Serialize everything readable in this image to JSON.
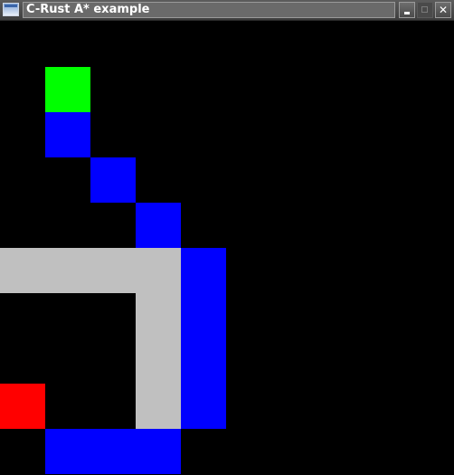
{
  "window": {
    "title": "C-Rust A* example",
    "buttons": {
      "minimize_icon": "minimize-icon",
      "maximize_icon": "maximize-icon",
      "close_icon": "close-icon",
      "close_glyph": "✕"
    }
  },
  "colors": {
    "background": "#000000",
    "start": "#00ff00",
    "goal": "#ff0000",
    "path": "#0000ff",
    "wall": "#c0c0c0"
  },
  "grid": {
    "cells": [
      {
        "kind": "start",
        "col": 1,
        "row": 1
      },
      {
        "kind": "path",
        "col": 1,
        "row": 2
      },
      {
        "kind": "path",
        "col": 2,
        "row": 3
      },
      {
        "kind": "path",
        "col": 3,
        "row": 4
      },
      {
        "kind": "wall",
        "col": 0,
        "row": 5
      },
      {
        "kind": "wall",
        "col": 1,
        "row": 5
      },
      {
        "kind": "wall",
        "col": 2,
        "row": 5
      },
      {
        "kind": "wall",
        "col": 3,
        "row": 5
      },
      {
        "kind": "path",
        "col": 4,
        "row": 5
      },
      {
        "kind": "wall",
        "col": 3,
        "row": 6
      },
      {
        "kind": "path",
        "col": 4,
        "row": 6
      },
      {
        "kind": "wall",
        "col": 3,
        "row": 7
      },
      {
        "kind": "path",
        "col": 4,
        "row": 7
      },
      {
        "kind": "goal",
        "col": 0,
        "row": 8
      },
      {
        "kind": "wall",
        "col": 3,
        "row": 8
      },
      {
        "kind": "path",
        "col": 4,
        "row": 8
      },
      {
        "kind": "path",
        "col": 1,
        "row": 9
      },
      {
        "kind": "path",
        "col": 2,
        "row": 9
      },
      {
        "kind": "path",
        "col": 3,
        "row": 9
      }
    ]
  }
}
